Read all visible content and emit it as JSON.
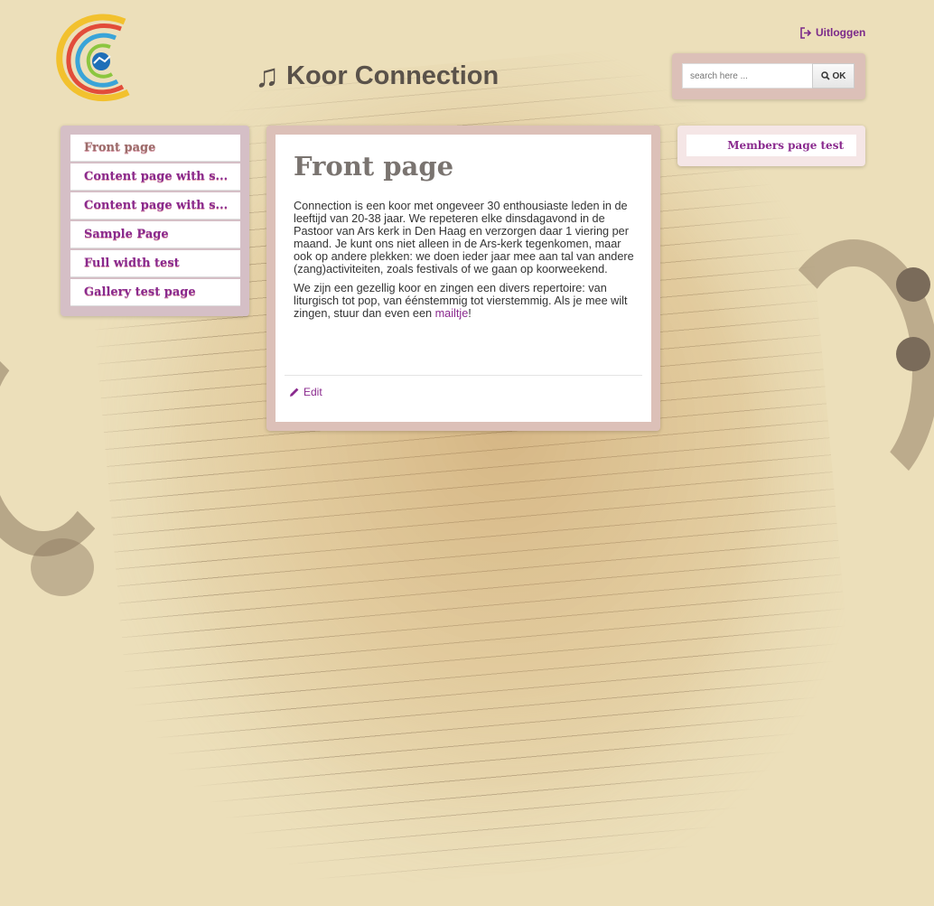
{
  "site": {
    "title": "Koor Connection",
    "logo_icon": "choir-logo",
    "title_icon": "music-note-icon"
  },
  "header": {
    "logout_label": "Uitloggen",
    "logout_icon": "logout-icon"
  },
  "search": {
    "placeholder": "search here ...",
    "button_label": "OK",
    "button_icon": "search-icon"
  },
  "sidebar": {
    "items": [
      {
        "label": "Front page",
        "active": true
      },
      {
        "label": "Content page with s..."
      },
      {
        "label": "Content page with s..."
      },
      {
        "label": "Sample Page"
      },
      {
        "label": "Full width test"
      },
      {
        "label": "Gallery test page"
      }
    ]
  },
  "main": {
    "title": "Front page",
    "paragraph1": "Connection is een koor met ongeveer 30 enthousiaste leden in de leeftijd van 20-38 jaar. We repeteren elke dinsdagavond in de Pastoor van Ars kerk in Den Haag en verzorgen daar 1 viering per maand. Je kunt ons niet alleen in de Ars-kerk tegenkomen, maar ook op andere plekken: we doen ieder jaar mee aan tal van andere (zang)activiteiten, zoals festivals of we gaan op koorweekend.",
    "paragraph2_before": "We zijn een gezellig koor en zingen een divers repertoire: van liturgisch tot pop, van éénstemmig tot vierstemmig. Als je mee wilt zingen, stuur dan even een ",
    "paragraph2_link": "mailtje",
    "paragraph2_after": "!",
    "edit_label": "Edit",
    "edit_icon": "pencil-icon"
  },
  "members": {
    "label": "Members page test"
  },
  "colors": {
    "accent": "#8a2a8e",
    "background": "#ecdfba",
    "frame": "#dcc0b8"
  }
}
